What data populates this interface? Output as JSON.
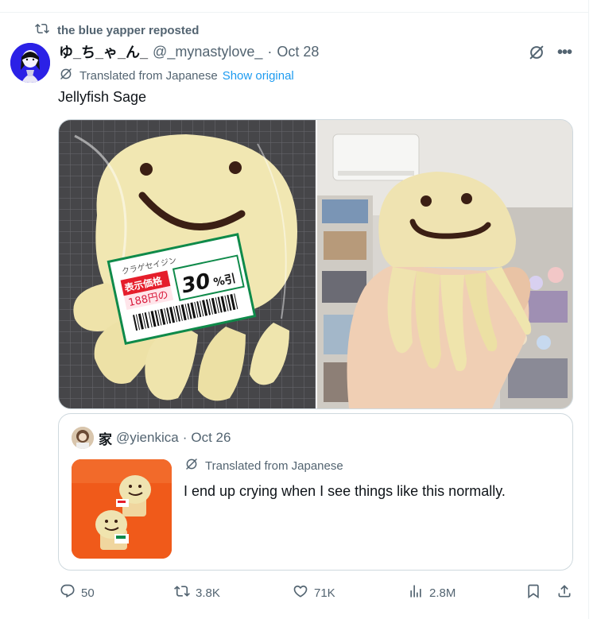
{
  "repost": {
    "label": "the blue yapper reposted"
  },
  "post": {
    "display_name": "ゆ_ち_ゃ_ん_",
    "handle": "@_mynastylove_",
    "dot": "·",
    "date": "Oct 28",
    "translated_label": "Translated from Japanese",
    "show_original": "Show original",
    "text": "Jellyfish Sage"
  },
  "media": {
    "left_price_label_kana": "クラゲセイジン",
    "left_price_label_red": "表示価格",
    "left_price_value": "188円の",
    "left_discount": "30",
    "left_discount_unit": "%引"
  },
  "quote": {
    "display_name": "家",
    "handle": "@yienkica",
    "dot": "·",
    "date": "Oct 26",
    "translated_label": "Translated from Japanese",
    "text": "I end up crying when I see things like this normally."
  },
  "actions": {
    "replies": "50",
    "reposts": "3.8K",
    "likes": "71K",
    "views": "2.8M"
  },
  "colors": {
    "accent": "#1d9bf0",
    "secondary_text": "#536471",
    "border": "#cfd9de"
  }
}
